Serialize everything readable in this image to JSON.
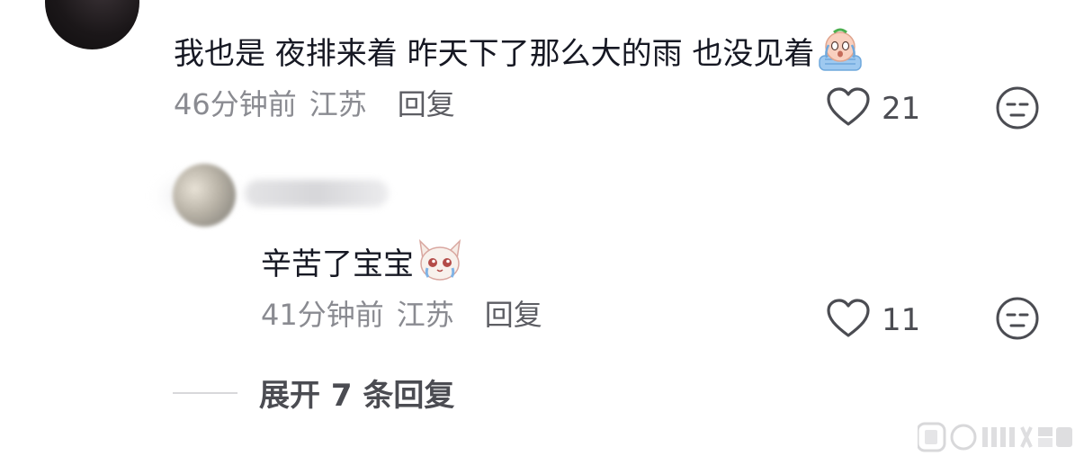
{
  "comment": {
    "text": "我也是 夜排来着 昨天下了那么大的雨 也没见着",
    "emoji": "crying-emoji",
    "time": "46分钟前",
    "location": "江苏",
    "reply_label": "回复",
    "likes": "21"
  },
  "reply": {
    "text": "辛苦了宝宝",
    "emoji": "crying-cat-emoji",
    "time": "41分钟前",
    "location": "江苏",
    "reply_label": "回复",
    "likes": "11"
  },
  "expand": {
    "label": "展开 7 条回复"
  },
  "colors": {
    "text": "#161823",
    "meta": "#8a8b91",
    "accent_gray": "#4b4c52"
  }
}
